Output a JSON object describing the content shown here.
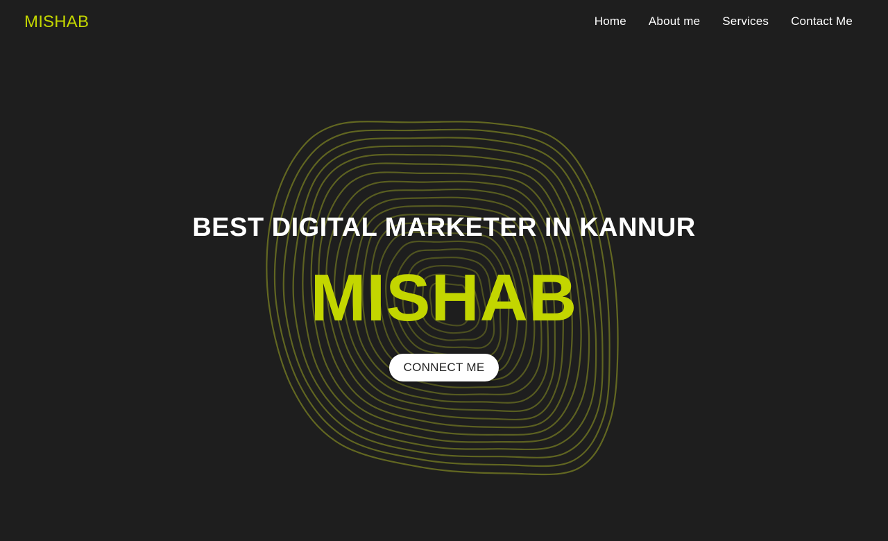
{
  "colors": {
    "background": "#1e1e1e",
    "accent": "#c3d600",
    "text": "#ffffff",
    "button_bg": "#ffffff",
    "button_text": "#222222",
    "contour_stroke": "#6e7422"
  },
  "navbar": {
    "logo": "MISHAB",
    "links": [
      {
        "label": "Home"
      },
      {
        "label": "About me"
      },
      {
        "label": "Services"
      },
      {
        "label": "Contact Me"
      }
    ]
  },
  "hero": {
    "subtitle": "BEST DIGITAL MARKETER IN KANNUR",
    "title": "MISHAB",
    "cta_label": "CONNECT ME",
    "background_graphic": "concentric-contour-lines"
  }
}
